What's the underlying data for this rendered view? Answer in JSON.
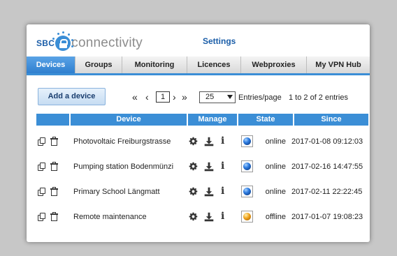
{
  "brand": {
    "sbc": "SBC",
    "name": "connectivity",
    "color": "#1a5da8"
  },
  "page_title": "Settings",
  "tabs": [
    {
      "label": "Devices",
      "active": true
    },
    {
      "label": "Groups"
    },
    {
      "label": "Monitoring"
    },
    {
      "label": "Licences"
    },
    {
      "label": "Webproxies"
    },
    {
      "label": "My VPN Hub"
    }
  ],
  "toolbar": {
    "add_label": "Add a device",
    "first": "«",
    "prev": "‹",
    "page": "1",
    "next": "›",
    "last": "»",
    "entries_value": "25",
    "entries_label": "Entries/page",
    "range_label": "1 to 2 of 2 entries"
  },
  "table": {
    "columns": [
      "Device",
      "Manage",
      "State",
      "Since"
    ],
    "rows": [
      {
        "device": "Photovoltaic Freiburgstrasse",
        "state": "online",
        "status_icon": "online-orb-icon",
        "since": "2017-01-08 09:12:03"
      },
      {
        "device": "Pumping station Bodenmünzi",
        "state": "online",
        "status_icon": "online-orb-icon",
        "since": "2017-02-16 14:47:55"
      },
      {
        "device": "Primary School Längmatt",
        "state": "online",
        "status_icon": "online-orb-icon",
        "since": "2017-02-11 22:22:45"
      },
      {
        "device": "Remote maintenance",
        "state": "offline",
        "status_icon": "offline-orb-icon",
        "since": "2017-01-07 19:08:23"
      }
    ],
    "row_icons": [
      "copy-icon",
      "trash-icon",
      "gear-icon",
      "download-icon",
      "info-icon"
    ]
  },
  "colors": {
    "accent": "#3b8ed6",
    "online": "#2c7be0",
    "offline": "#f0a21c"
  }
}
